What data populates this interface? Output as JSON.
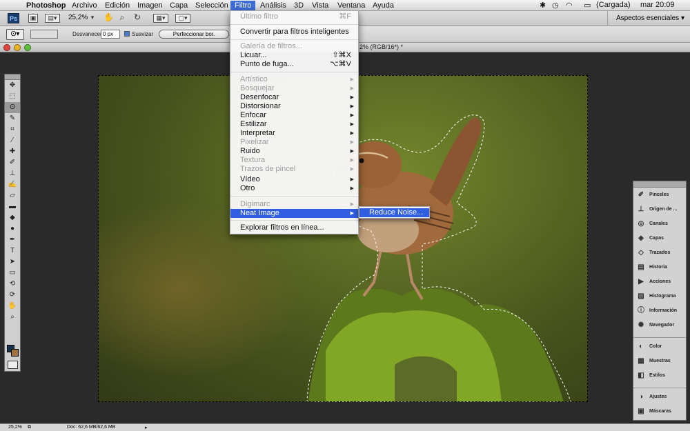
{
  "menubar": {
    "app_name": "Photoshop",
    "items": [
      "Archivo",
      "Edición",
      "Imagen",
      "Capa",
      "Selección",
      "Filtro",
      "Análisis",
      "3D",
      "Vista",
      "Ventana",
      "Ayuda"
    ],
    "battery": "(Cargada)",
    "clock": "mar 20:09"
  },
  "appbar": {
    "zoom": "25,2%",
    "workspace": "Aspectos esenciales"
  },
  "options": {
    "feather_label": "Desvanecer:",
    "feather_value": "0 px",
    "antialias_label": "Suavizar",
    "refine_button": "Perfeccionar bor."
  },
  "document": {
    "title_fragment": "2% (RGB/16*) *"
  },
  "filter_menu": {
    "last_filter": "Último filtro",
    "last_filter_sc": "⌘F",
    "smart": "Convertir para filtros inteligentes",
    "gallery": "Galería de filtros...",
    "liquify": "Licuar...",
    "liquify_sc": "⇧⌘X",
    "vanishing": "Punto de fuga...",
    "vanishing_sc": "⌥⌘V",
    "artistic": "Artístico",
    "sketch": "Bosquejar",
    "blur": "Desenfocar",
    "distort": "Distorsionar",
    "sharpen": "Enfocar",
    "stylize": "Estilizar",
    "render": "Interpretar",
    "pixelate": "Pixelizar",
    "noise": "Ruido",
    "texture": "Textura",
    "brush": "Trazos de pincel",
    "video": "Vídeo",
    "other": "Otro",
    "digimarc": "Digimarc",
    "neat_image": "Neat Image",
    "browse": "Explorar filtros en línea..."
  },
  "submenu": {
    "reduce_noise": "Reduce Noise..."
  },
  "panels": {
    "group1": [
      "Pinceles",
      "Origen de ...",
      "Canales",
      "Capas",
      "Trazados",
      "Historia",
      "Acciones",
      "Histograma",
      "Información",
      "Navegador"
    ],
    "group2": [
      "Color",
      "Muestras",
      "Estilos"
    ],
    "group3": [
      "Ajustes",
      "Máscaras"
    ]
  },
  "statusbar": {
    "zoom": "25,2%",
    "doc": "Doc: 62,6 MB/62,6 MB"
  },
  "colors": {
    "menu_highlight": "#2f5fe0",
    "foreground_swatch": "#15324e",
    "background_swatch": "#a1733c"
  }
}
